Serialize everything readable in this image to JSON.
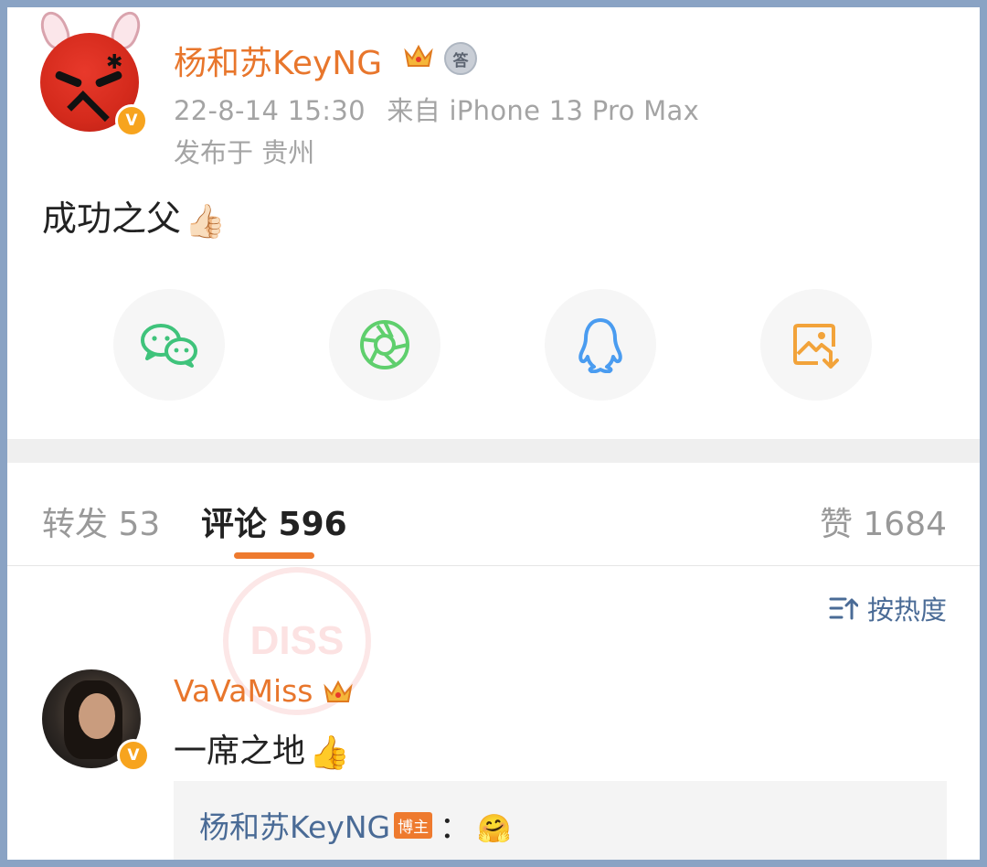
{
  "post": {
    "author": "杨和苏KeyNG",
    "timestamp": "22-8-14 15:30",
    "source": "来自 iPhone 13 Pro Max",
    "location": "发布于 贵州",
    "content": "成功之父",
    "content_emoji": "👍🏻",
    "verified_badge": "V"
  },
  "share": {
    "icons": [
      "wechat-icon",
      "moments-icon",
      "qq-icon",
      "save-image-icon"
    ]
  },
  "tabs": {
    "repost": "转发 53",
    "comment": "评论 596",
    "like": "赞 1684"
  },
  "sort": {
    "label": "按热度"
  },
  "watermark": {
    "text": "DISS"
  },
  "comment": {
    "author": "VaVaMiss",
    "text": "一席之地",
    "emoji": "👍",
    "verified_badge": "V",
    "reply": {
      "author": "杨和苏KeyNG",
      "tag": "博主",
      "colon": "：",
      "emoji": "🤗"
    }
  },
  "colors": {
    "accent": "#ee7a2e",
    "link": "#4a6b96",
    "wechat": "#3fc37b",
    "moments": "#5fcf6d",
    "qq": "#4a9cf0",
    "save": "#f2a33a"
  }
}
